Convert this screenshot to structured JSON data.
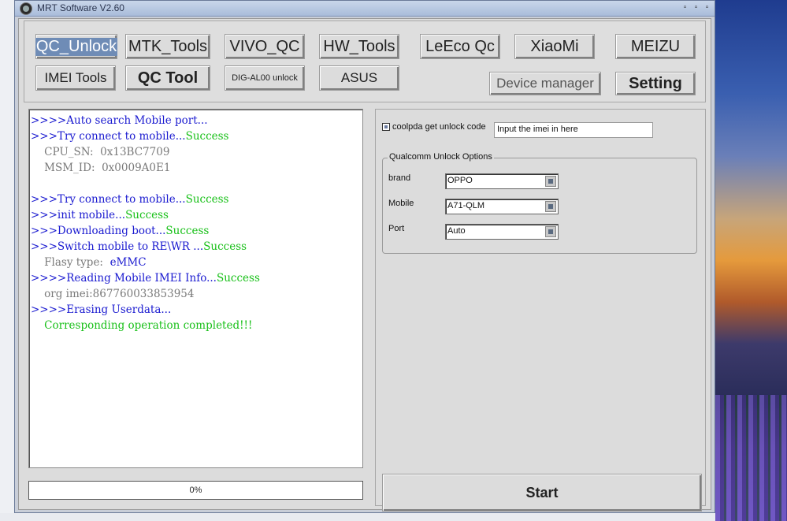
{
  "window": {
    "title": "MRT Software V2.60"
  },
  "toolbar": {
    "qc_unlock": "QC_Unlock",
    "mtk_tools": "MTK_Tools",
    "vivo_qc": "VIVO_QC",
    "hw_tools": "HW_Tools",
    "leeco_qc": "LeEco Qc",
    "xiaomi": "XiaoMi",
    "meizu": "MEIZU",
    "imei_tools": "IMEI Tools",
    "qc_tool": "QC Tool",
    "dig_al00_unlock": "DIG-AL00 unlock",
    "asus": "ASUS",
    "device_manager": "Device manager",
    "setting": "Setting"
  },
  "log": [
    {
      "prefix": ">>>>Auto search Mobile port...",
      "suffix": ""
    },
    {
      "prefix": ">>>Try connect to mobile...",
      "suffix": "Success"
    },
    {
      "prefix": "    CPU_SN:  0x13BC7709",
      "suffix": ""
    },
    {
      "prefix": "    MSM_ID:  0x0009A0E1",
      "suffix": ""
    },
    {
      "prefix": "",
      "suffix": ""
    },
    {
      "prefix": ">>>Try connect to mobile...",
      "suffix": "Success"
    },
    {
      "prefix": ">>>init mobile...",
      "suffix": "Success"
    },
    {
      "prefix": ">>>Downloading boot...",
      "suffix": "Success"
    },
    {
      "prefix": ">>>Switch mobile to RE\\WR ...",
      "suffix": "Success"
    },
    {
      "prefix": "    Flasy type:  ",
      "suffix": "eMMC"
    },
    {
      "prefix": ">>>>Reading Mobile IMEI Info...",
      "suffix": "Success"
    },
    {
      "prefix": "    org imei:867760033853954",
      "suffix": ""
    },
    {
      "prefix": ">>>>Erasing Userdata...",
      "suffix": ""
    },
    {
      "prefix": "",
      "suffix": "    Corresponding operation completed!!!"
    }
  ],
  "progress": {
    "percent_label": "0%",
    "value": 0
  },
  "unlock": {
    "coolpda_label": "coolpda get unlock code",
    "imei_value": "Input the imei in here"
  },
  "options": {
    "group_label": "Qualcomm Unlock Options",
    "brand_label": "brand",
    "brand_value": "OPPO",
    "mobile_label": "Mobile",
    "mobile_value": "A71-QLM",
    "port_label": "Port",
    "port_value": "Auto"
  },
  "start_label": "Start"
}
